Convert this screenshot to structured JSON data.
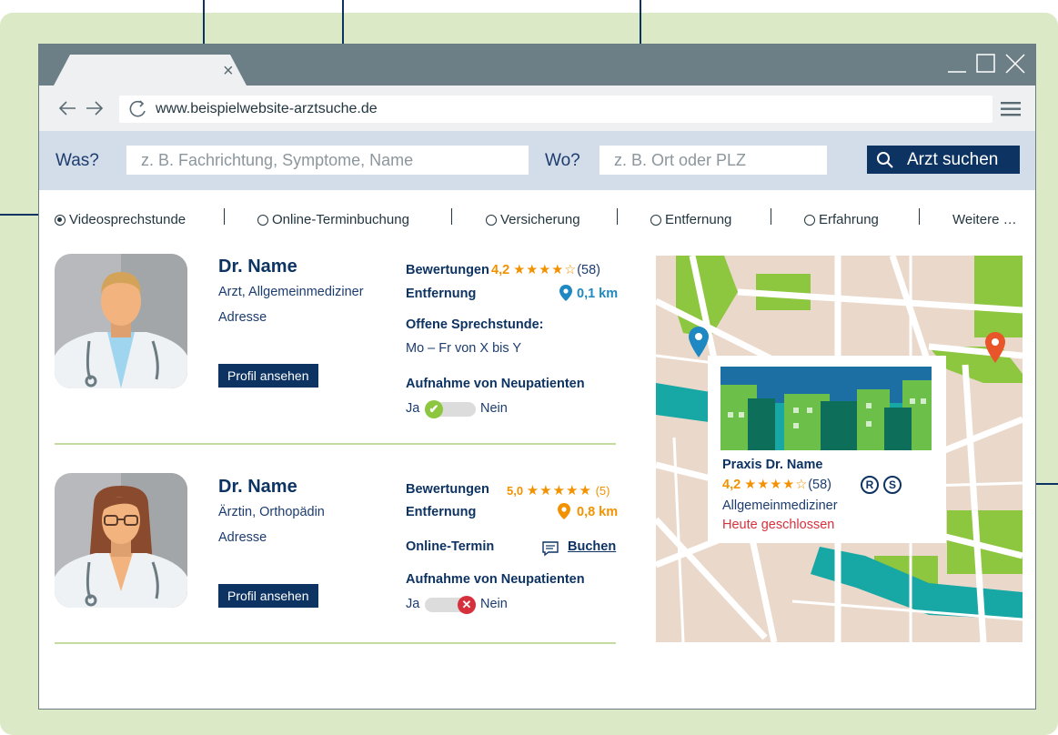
{
  "browser": {
    "tab_close": "×",
    "url": "www.beispielwebsite-arztsuche.de"
  },
  "search": {
    "what_label": "Was?",
    "what_placeholder": "z. B. Fachrichtung, Symptome, Name",
    "where_label": "Wo?",
    "where_placeholder": "z. B. Ort oder PLZ",
    "button": "Arzt suchen"
  },
  "filters": [
    {
      "label": "Videosprechstunde",
      "selected": true
    },
    {
      "label": "Online-Terminbuchung",
      "selected": false
    },
    {
      "label": "Versicherung",
      "selected": false
    },
    {
      "label": "Entfernung",
      "selected": false
    },
    {
      "label": "Erfahrung",
      "selected": false
    },
    {
      "label": "Weitere …",
      "selected": false
    }
  ],
  "doctors": [
    {
      "name": "Dr. Name",
      "specialty": "Arzt, Allgemeinmediziner",
      "address": "Adresse",
      "profile_button": "Profil ansehen",
      "ratings_label": "Bewertungen",
      "rating": "4,2",
      "rating_stars": "★★★★☆",
      "rating_count": "(58)",
      "distance_label": "Entfernung",
      "distance": "0,1 km",
      "hours_label": "Offene Sprechstunde:",
      "hours": "Mo – Fr von X bis  Y",
      "new_patients_label": "Aufnahme von Neupatienten",
      "yes": "Ja",
      "no": "Nein",
      "accepts_new_patients": true
    },
    {
      "name": "Dr. Name",
      "specialty": "Ärztin, Orthopädin",
      "address": "Adresse",
      "profile_button": "Profil ansehen",
      "ratings_label": "Bewertungen",
      "rating": "5,0",
      "rating_stars": "★★★★★",
      "rating_count": "(5)",
      "distance_label": "Entfernung",
      "distance": "0,8 km",
      "online_label": "Online-Termin",
      "book_label": "Buchen",
      "new_patients_label": "Aufnahme von Neupatienten",
      "yes": "Ja",
      "no": "Nein",
      "accepts_new_patients": false
    }
  ],
  "map_popup": {
    "title": "Praxis Dr. Name",
    "rating": "4,2",
    "rating_stars": "★★★★☆",
    "rating_count": "(58)",
    "badge_r": "R",
    "badge_s": "S",
    "specialty": "Allgemeinmediziner",
    "status": "Heute geschlossen"
  },
  "colors": {
    "navy": "#0d3363",
    "orange": "#f39200",
    "blue": "#1e88c2",
    "green": "#8dc63f",
    "red": "#d7303d",
    "teal": "#17a7a5"
  }
}
